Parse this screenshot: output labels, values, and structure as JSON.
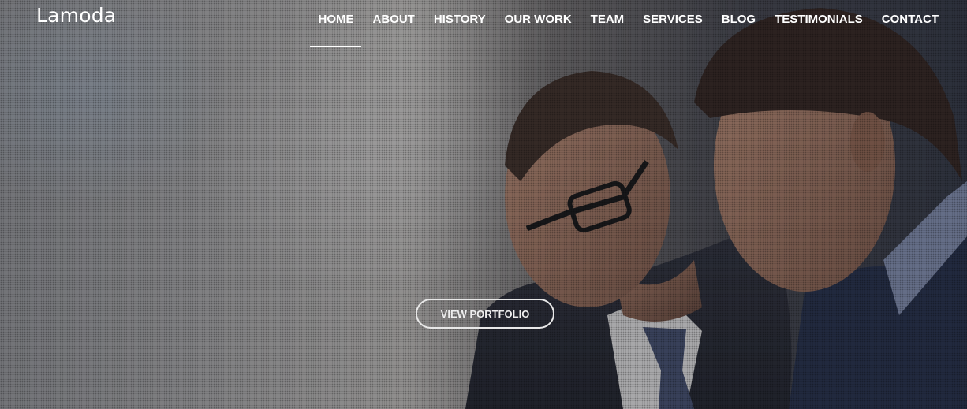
{
  "brand": {
    "name": "Lamoda"
  },
  "nav": {
    "items": [
      {
        "label": "HOME",
        "active": true
      },
      {
        "label": "ABOUT",
        "active": false
      },
      {
        "label": "HISTORY",
        "active": false
      },
      {
        "label": "OUR WORK",
        "active": false
      },
      {
        "label": "TEAM",
        "active": false
      },
      {
        "label": "SERVICES",
        "active": false
      },
      {
        "label": "BLOG",
        "active": false
      },
      {
        "label": "TESTIMONIALS",
        "active": false
      },
      {
        "label": "CONTACT",
        "active": false
      }
    ]
  },
  "hero": {
    "cta_label": "VIEW PORTFOLIO",
    "background_image": "two-businessmen-photo"
  },
  "colors": {
    "text": "#ffffff",
    "active_underline": "#ffffff",
    "cta_border": "#e8e8e8"
  }
}
